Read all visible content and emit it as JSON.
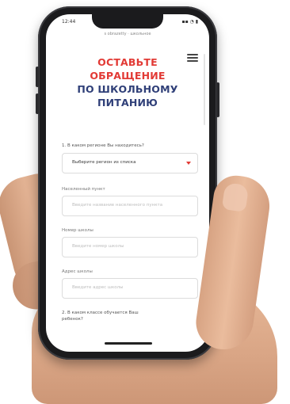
{
  "status_bar": {
    "time": "12:44",
    "icons_text": "▪▪ ◔ ▮",
    "url": "s obrazetty · школьное"
  },
  "header": {
    "title_line1": "ОСТАВЬТЕ",
    "title_line2": "ОБРАЩЕНИЕ",
    "title_line3": "ПО ШКОЛЬНОМУ",
    "title_line4": "ПИТАНИЮ",
    "menu_icon": "hamburger-menu-icon"
  },
  "form": {
    "q1_label": "1. В каком регионе Вы находитесь?",
    "region_select_value": "Выберите регион из списка",
    "settlement_label": "Населенный пункт",
    "settlement_placeholder": "Введите название населенного пункта",
    "school_number_label": "Номер школы",
    "school_number_placeholder": "Введите номер школы",
    "school_address_label": "Адрес школы",
    "school_address_placeholder": "Введите адрес школы",
    "q2_label": "2. В каком классе обучается Ваш ребенок?"
  },
  "colors": {
    "accent_red": "#e23a35",
    "title_blue": "#2f3f78"
  }
}
